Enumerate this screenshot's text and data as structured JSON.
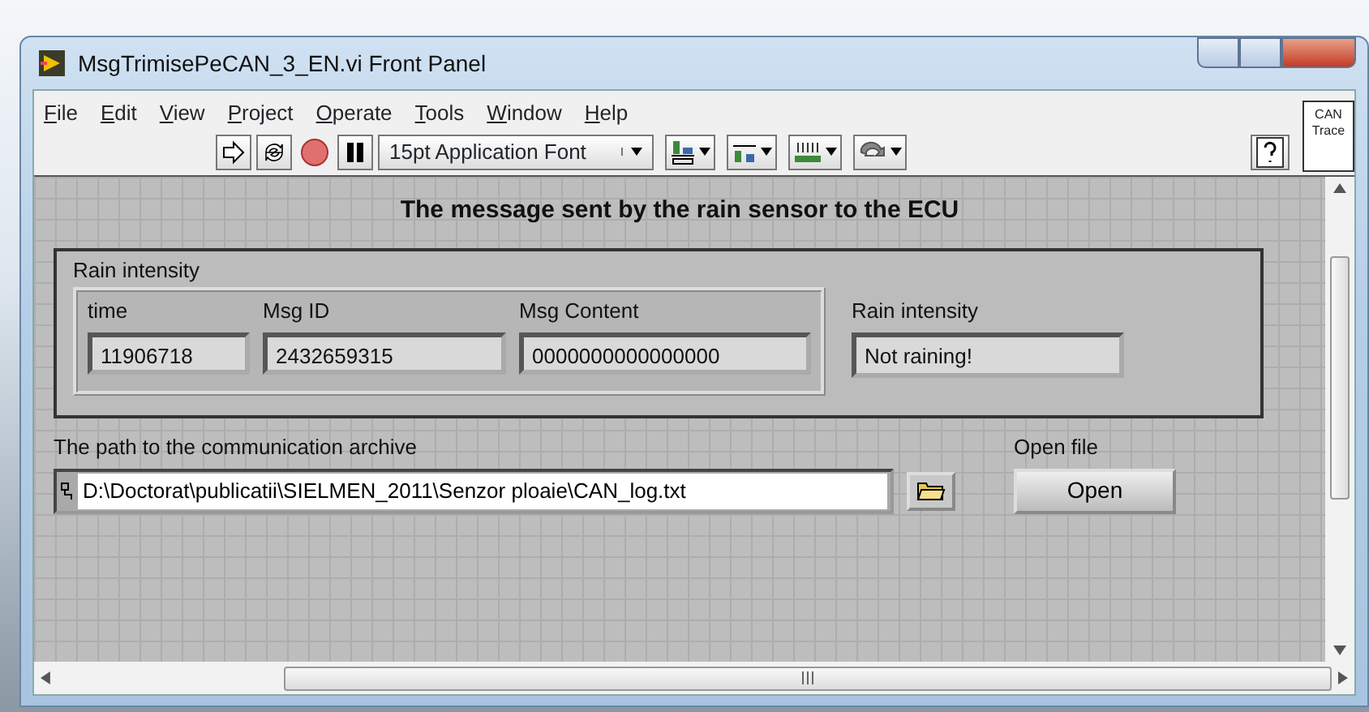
{
  "window": {
    "title": "MsgTrimisePeCAN_3_EN.vi Front Panel"
  },
  "menu": [
    "File",
    "Edit",
    "View",
    "Project",
    "Operate",
    "Tools",
    "Window",
    "Help"
  ],
  "toolbar": {
    "font_menu": "15pt Application Font",
    "side_label": "CAN Trace"
  },
  "panel": {
    "heading": "The message sent by the rain sensor to the ECU",
    "cluster": {
      "label": "Rain intensity",
      "fields": [
        {
          "label": "time",
          "value": "11906718"
        },
        {
          "label": "Msg ID",
          "value": "2432659315"
        },
        {
          "label": "Msg Content",
          "value": "0000000000000000"
        }
      ],
      "indicator": {
        "label": "Rain intensity",
        "value": "Not raining!"
      }
    },
    "path": {
      "label": "The path to the communication archive",
      "value": "D:\\Doctorat\\publicatii\\SIELMEN_2011\\Senzor ploaie\\CAN_log.txt"
    },
    "open": {
      "label": "Open file",
      "button": "Open"
    }
  }
}
